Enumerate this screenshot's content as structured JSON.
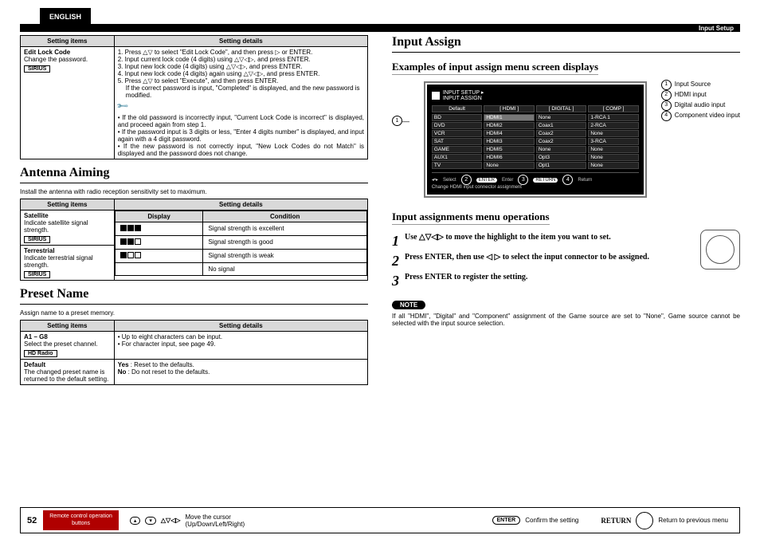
{
  "header": {
    "language": "ENGLISH",
    "section": "Input Setup"
  },
  "lock": {
    "col1_h": "Setting items",
    "col2_h": "Setting details",
    "item": "Edit Lock Code",
    "desc": "Change the password.",
    "badge": "SIRIUS",
    "s1": "1. Press △▽ to select \"Edit Lock Code\", and then press ▷ or ENTER.",
    "s2": "2. Input current lock code (4 digits) using △▽◁▷, and press ENTER.",
    "s3": "3. Input new lock code (4 digits) using △▽◁▷, and press ENTER.",
    "s4": "4. Input new lock code (4 digits) again using △▽◁▷, and press ENTER.",
    "s5": "5. Press △▽ to select \"Execute\", and then press ENTER.",
    "s5b": "If the correct password is input, \"Completed\" is displayed, and the new password is modified.",
    "b1": "• If the old password is incorrectly input, \"Current Lock Code is incorrect\" is displayed, and proceed again from step 1.",
    "b2": "• If the password input is 3 digits or less, \"Enter 4 digits number\" is displayed, and input again with a 4 digit password.",
    "b3": "• If the new password is not correctly input, \"New Lock Codes do not Match\" is displayed and the password does not change."
  },
  "antenna": {
    "title": "Antenna Aiming",
    "intro": "Install the antenna with radio reception sensitivity set to maximum.",
    "col1_h": "Setting items",
    "col2_h": "Setting details",
    "r1": "Satellite",
    "r1d": "Indicate satellite signal strength.",
    "r1b": "SIRIUS",
    "r2": "Terrestrial",
    "r2d": "Indicate terrestrial signal strength.",
    "r2b": "SIRIUS",
    "disp_h": "Display",
    "cond_h": "Condition",
    "c1": "Signal strength is excellent",
    "c2": "Signal strength is good",
    "c3": "Signal strength is weak",
    "c4": "No signal"
  },
  "preset": {
    "title": "Preset Name",
    "intro": "Assign name to a preset memory.",
    "col1_h": "Setting items",
    "col2_h": "Setting details",
    "r1": "A1 – G8",
    "r1d": "Select the preset channel.",
    "r1b": "HD Radio",
    "r1det": "• Up to eight characters can be input.\n• For character input, see page 49.",
    "r2": "Default",
    "r2d": "The changed preset name is returned to the default setting.",
    "r2det_y": "Yes",
    "r2det_yt": " : Reset to the defaults.",
    "r2det_n": "No",
    "r2det_nt": " : Do not reset to the defaults."
  },
  "assign": {
    "title": "Input Assign",
    "sub1": "Examples of input assign menu screen displays",
    "legend": [
      "Input Source",
      "HDMI input",
      "Digital audio input",
      "Component video input"
    ],
    "osd": {
      "hdr1": "INPUT SETUP ▸",
      "hdr2": "INPUT ASSIGN",
      "heads": [
        "Default",
        "[ HDMI ]",
        "[ DIGITAL ]",
        "[ COMP ]"
      ],
      "rows": [
        [
          "BD",
          "HDMI1",
          "None",
          "1-RCA 1"
        ],
        [
          "DVD",
          "HDMI2",
          "Coax1",
          "2-RCA"
        ],
        [
          "VCR",
          "HDMI4",
          "Coax2",
          "None"
        ],
        [
          "SAT",
          "HDMI3",
          "Coax2",
          "3-RCA"
        ],
        [
          "GAME",
          "HDMI5",
          "None",
          "None"
        ],
        [
          "AUX1",
          "HDMI6",
          "Opt3",
          "None"
        ],
        [
          "TV",
          "None",
          "Opt1",
          "None"
        ]
      ],
      "foot_sel": "Select",
      "foot_ent": "Enter",
      "foot_ret": "Return",
      "foot2": "Change HDMI input connector assignment"
    },
    "sub2": "Input assignments menu operations",
    "step1": "Use △▽◁▷ to move the highlight to the item you want to set.",
    "step2a": "Press ",
    "step2b": "ENTER",
    "step2c": ", then use ◁ ▷ to select the input connector to be assigned.",
    "step3a": "Press ",
    "step3b": "ENTER",
    "step3c": " to register the setting.",
    "note_lbl": "NOTE",
    "note": "If all \"HDMI\", \"Digital\" and \"Component\" assignment of the Game source are set to \"None\", Game source cannot be selected with the input source selection."
  },
  "footer": {
    "page": "52",
    "red1": "Remote control operation",
    "red2": "buttons",
    "cursor": "Move the cursor",
    "cursor2": "(Up/Down/Left/Right)",
    "enter": "ENTER",
    "enter_t": "Confirm the setting",
    "return": "RETURN",
    "return_t": "Return to previous menu"
  }
}
